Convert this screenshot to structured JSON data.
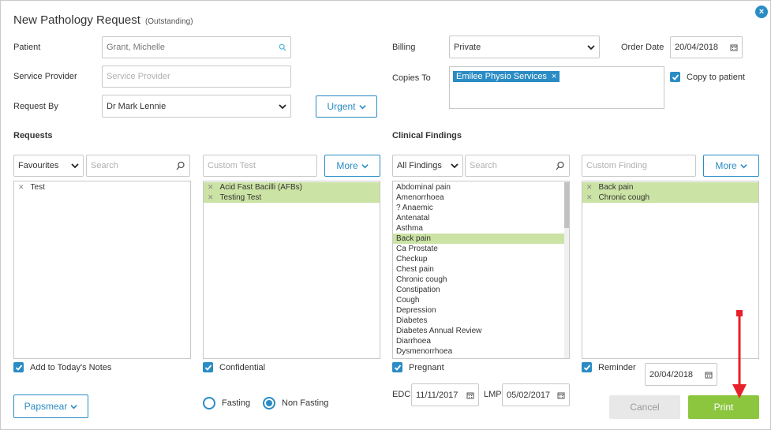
{
  "dialog": {
    "title": "New Pathology Request",
    "status": "(Outstanding)"
  },
  "labels": {
    "patient": "Patient",
    "service_provider": "Service Provider",
    "request_by": "Request By",
    "billing": "Billing",
    "copies_to": "Copies To",
    "order_date": "Order Date",
    "requests": "Requests",
    "clinical_findings": "Clinical Findings",
    "edc": "EDC",
    "lmp": "LMP"
  },
  "fields": {
    "patient": "Grant, Michelle",
    "service_provider_placeholder": "Service Provider",
    "request_by": "Dr Mark Lennie",
    "billing": "Private",
    "order_date": "20/04/2018",
    "copies_to_tag": "Emilee Physio Services",
    "copy_to_patient": "Copy to patient",
    "edc": "11/11/2017",
    "lmp": "05/02/2017",
    "reminder_date": "20/04/2018"
  },
  "buttons": {
    "urgent": "Urgent",
    "more_requests": "More",
    "more_findings": "More",
    "papsmear": "Papsmear",
    "cancel": "Cancel",
    "print": "Print"
  },
  "requests": {
    "filter": "Favourites",
    "search_placeholder": "Search",
    "custom_placeholder": "Custom Test",
    "favourites": [
      "Test"
    ],
    "selected": [
      "Acid Fast Bacilli (AFBs)",
      "Testing Test"
    ]
  },
  "findings": {
    "filter": "All Findings",
    "search_placeholder": "Search",
    "custom_placeholder": "Custom Finding",
    "list": [
      "Abdominal pain",
      "Amenorrhoea",
      "? Anaemic",
      "Antenatal",
      "Asthma",
      "Back pain",
      "Ca Prostate",
      "Checkup",
      "Chest pain",
      "Chronic cough",
      "Constipation",
      "Cough",
      "Depression",
      "Diabetes",
      "Diabetes Annual Review",
      "Diarrhoea",
      "Dysmenorrhoea"
    ],
    "highlighted": "Back pain",
    "selected": [
      "Back pain",
      "Chronic cough"
    ]
  },
  "checkboxes": {
    "add_to_notes": "Add to Today's Notes",
    "confidential": "Confidential",
    "pregnant": "Pregnant",
    "reminder": "Reminder"
  },
  "radios": {
    "fasting": "Fasting",
    "non_fasting": "Non Fasting",
    "selected": "Non Fasting"
  },
  "colors": {
    "accent": "#2a8cc4",
    "selected_row": "#cbe3a4",
    "print": "#8cc63f",
    "annotation_arrow": "#e8202a"
  }
}
